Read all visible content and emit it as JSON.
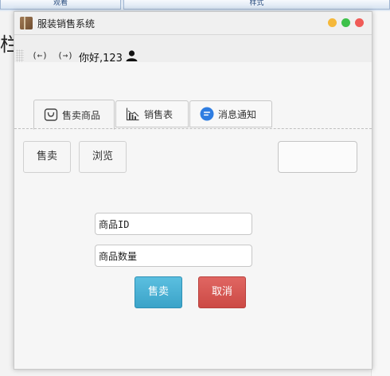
{
  "background": {
    "tab_left": "观看",
    "tab_right": "样式",
    "left_text": "栏图"
  },
  "window": {
    "title": "服装销售系统",
    "controls": {
      "minimize": "#f5b83a",
      "maximize": "#3ec14a",
      "close": "#f05b57"
    }
  },
  "nav": {
    "back": "(←)",
    "forward": "(→)",
    "greeting": "你好,123",
    "user_icon": "user-icon"
  },
  "tabs": [
    {
      "label": "售卖商品",
      "icon": "bag-icon",
      "active": true
    },
    {
      "label": "销售表",
      "icon": "chart-icon",
      "active": false
    },
    {
      "label": "消息通知",
      "icon": "message-icon",
      "active": false
    }
  ],
  "actions": {
    "sell": "售卖",
    "browse": "浏览"
  },
  "form": {
    "product_id": "商品ID",
    "quantity": "商品数量",
    "submit": "售卖",
    "cancel": "取消"
  },
  "colors": {
    "primary_button": "#3ba3c8",
    "danger_button": "#cc4a45",
    "message_icon": "#2f7de1"
  }
}
